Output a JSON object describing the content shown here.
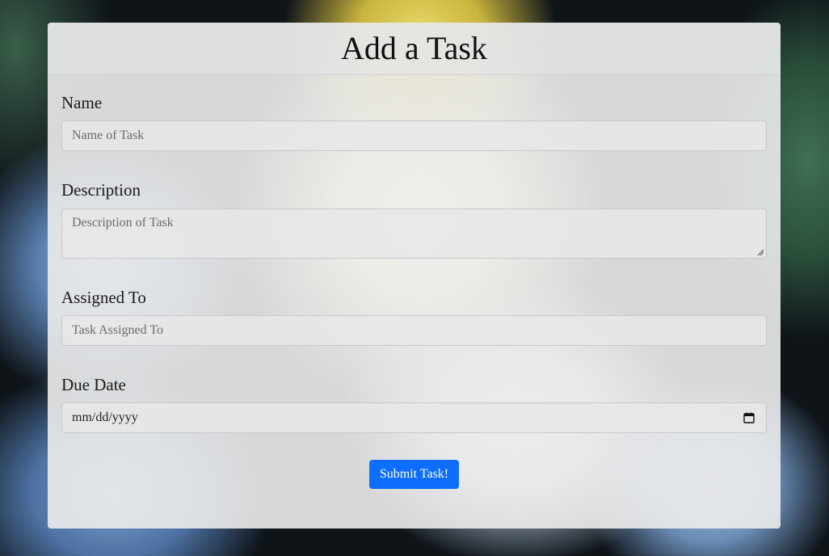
{
  "form": {
    "title": "Add a Task",
    "fields": {
      "name": {
        "label": "Name",
        "placeholder": "Name of Task",
        "value": ""
      },
      "description": {
        "label": "Description",
        "placeholder": "Description of Task",
        "value": ""
      },
      "assigned_to": {
        "label": "Assigned To",
        "placeholder": "Task Assigned To",
        "value": ""
      },
      "due_date": {
        "label": "Due Date",
        "value": "mm/dd/yyyy",
        "icon": "calendar-icon"
      }
    },
    "submit_label": "Submit Task!"
  },
  "colors": {
    "primary_button": "#0d6efd",
    "card_background": "#ececec"
  }
}
